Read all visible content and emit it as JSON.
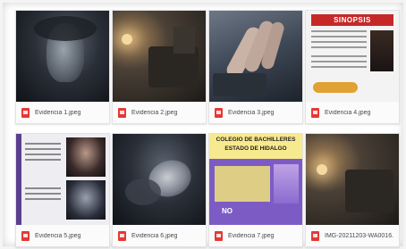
{
  "files": [
    {
      "name": "Evidencia 1.jpeg",
      "icon": "image-file-icon"
    },
    {
      "name": "Evidencia 2.jpeg",
      "icon": "image-file-icon"
    },
    {
      "name": "Evidencia 3.jpeg",
      "icon": "image-file-icon"
    },
    {
      "name": "Evidencia 4.jpeg",
      "icon": "image-file-icon"
    },
    {
      "name": "Evidencia 5.jpeg",
      "icon": "image-file-icon"
    },
    {
      "name": "Evidencia 6.jpeg",
      "icon": "image-file-icon"
    },
    {
      "name": "Evidencia 7.jpeg",
      "icon": "image-file-icon"
    },
    {
      "name": "IMG-20211203-WA0016.",
      "icon": "image-file-icon"
    }
  ],
  "thumbs": {
    "sinopsis_title": "SINOPSIS",
    "colegio_line1": "COLEGIO DE BACHILLERES",
    "colegio_line2": "ESTADO DE HIDALGO",
    "colegio_no": "NO"
  },
  "colors": {
    "file_icon": "#e53935",
    "sinopsis_banner": "#c62828",
    "colegio_banner": "#f7e98e"
  }
}
